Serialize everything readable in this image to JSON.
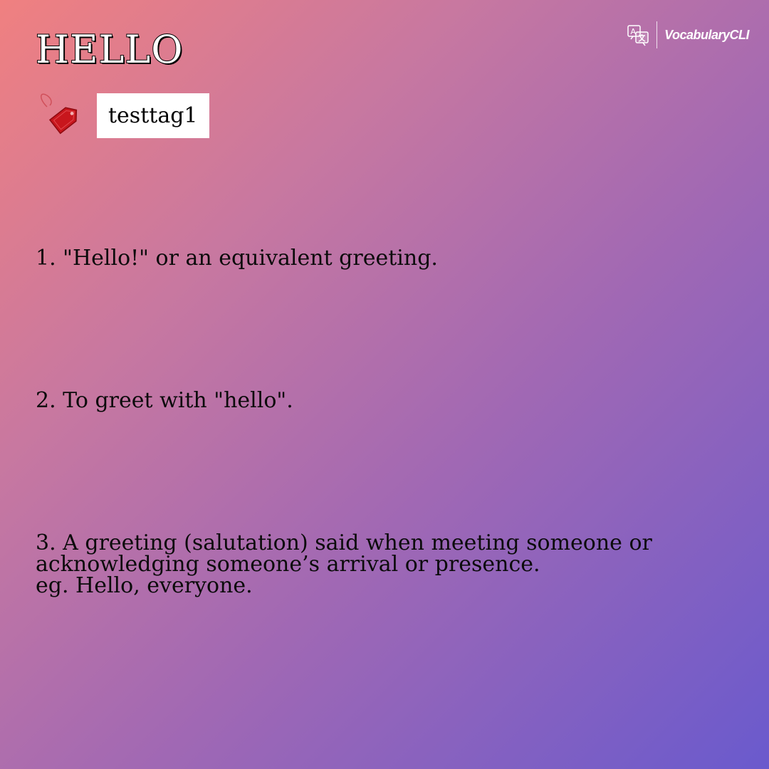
{
  "card": {
    "word": "HELLO",
    "tag": "testtag1",
    "brand": {
      "name": "VocabularyCLI",
      "icon": "translate-icon"
    },
    "tag_icon": "price-tag-icon",
    "definitions": [
      {
        "text": "1. \"Hello!\" or an equivalent greeting."
      },
      {
        "text": "2. To greet with \"hello\"."
      },
      {
        "text": "3. A greeting (salutation) said when meeting someone or\nacknowledging someone’s arrival or presence.\n eg. Hello, everyone."
      }
    ]
  },
  "colors": {
    "gradient_start": "#f08080",
    "gradient_end": "#6a5acd",
    "tag_red": "#c8161d",
    "text": "#0b0b0b"
  }
}
